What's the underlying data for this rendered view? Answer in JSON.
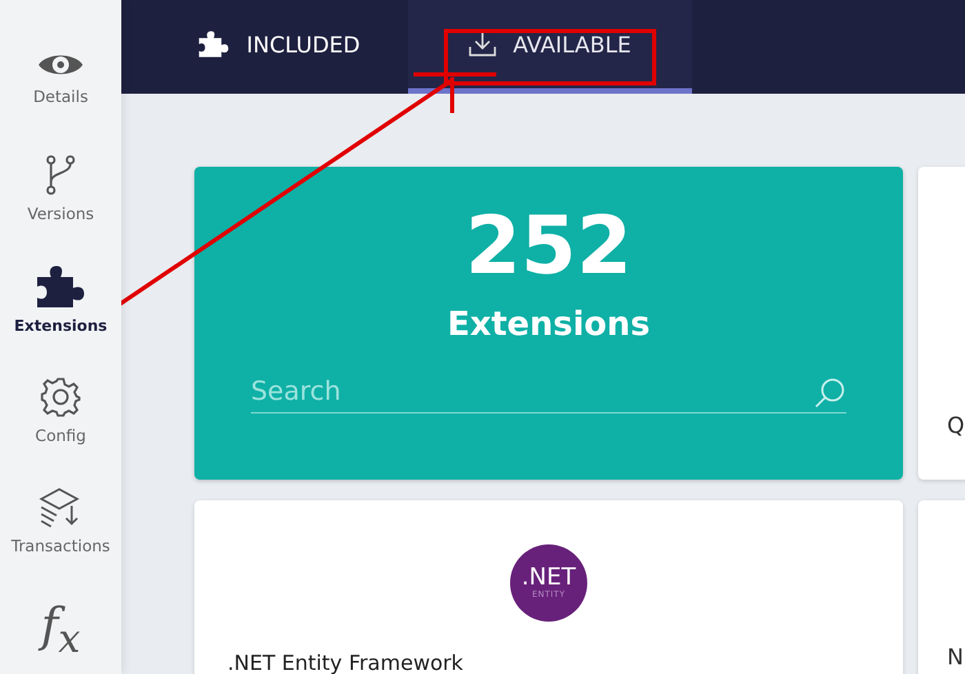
{
  "sidebar": {
    "items": [
      {
        "kind": "eye",
        "label": "Details",
        "selected": false
      },
      {
        "kind": "branch",
        "label": "Versions",
        "selected": false
      },
      {
        "kind": "puzzle",
        "label": "Extensions",
        "selected": true
      },
      {
        "kind": "gear",
        "label": "Config",
        "selected": false
      },
      {
        "kind": "layers",
        "label": "Transactions",
        "selected": false
      },
      {
        "kind": "glyph",
        "glyph": "f$_{x}$",
        "selected": false
      }
    ]
  },
  "tabs": [
    {
      "kind": "puzzle",
      "label": "INCLUDED",
      "selected": false
    },
    {
      "kind": "download",
      "label": "AVAILABLE",
      "selected": true
    }
  ],
  "summary": {
    "count": "252",
    "label": "Extensions",
    "search": {
      "placeholder": "Search"
    }
  },
  "side_cards": [
    {
      "text": "Q"
    },
    {
      "text": "N"
    }
  ],
  "extensions": [
    {
      "title": ".NET Entity Framework",
      "logo_text": ".NET",
      "logo_subtext": "ENTITY"
    }
  ]
}
